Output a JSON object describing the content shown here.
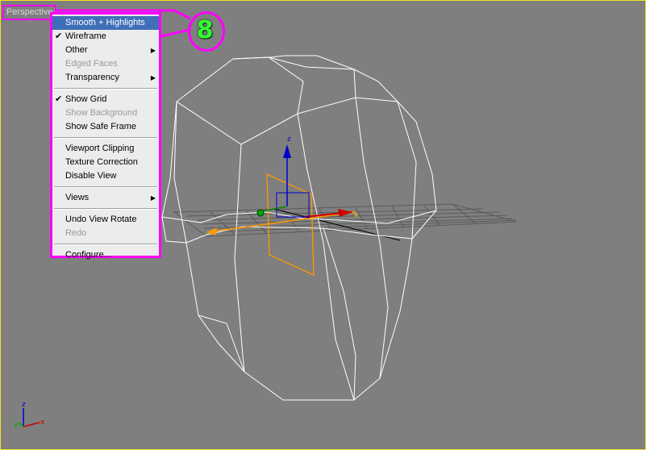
{
  "viewport": {
    "label": "Perspective",
    "background_color": "#7f7f7f",
    "active_border_color": "#f2e21d"
  },
  "annotation": {
    "number": "8",
    "outline_color": "#ff00ff",
    "number_color": "#33ff33"
  },
  "axis_tripod": {
    "z": "z",
    "y": "y",
    "x": "x"
  },
  "gizmo": {
    "z": "z",
    "x": "x"
  },
  "context_menu": {
    "highlight_color": "#3f6fb8",
    "items": [
      {
        "label": "Smooth + Highlights",
        "highlighted": true,
        "enabled": true,
        "checked": false,
        "submenu": false
      },
      {
        "label": "Wireframe",
        "highlighted": false,
        "enabled": true,
        "checked": true,
        "submenu": false
      },
      {
        "label": "Other",
        "highlighted": false,
        "enabled": true,
        "checked": false,
        "submenu": true
      },
      {
        "label": "Edged Faces",
        "highlighted": false,
        "enabled": false,
        "checked": false,
        "submenu": false
      },
      {
        "label": "Transparency",
        "highlighted": false,
        "enabled": true,
        "checked": false,
        "submenu": true
      },
      {
        "separator": true
      },
      {
        "label": "Show Grid",
        "highlighted": false,
        "enabled": true,
        "checked": true,
        "submenu": false
      },
      {
        "label": "Show Background",
        "highlighted": false,
        "enabled": false,
        "checked": false,
        "submenu": false
      },
      {
        "label": "Show Safe Frame",
        "highlighted": false,
        "enabled": true,
        "checked": false,
        "submenu": false
      },
      {
        "separator": true
      },
      {
        "label": "Viewport Clipping",
        "highlighted": false,
        "enabled": true,
        "checked": false,
        "submenu": false
      },
      {
        "label": "Texture Correction",
        "highlighted": false,
        "enabled": true,
        "checked": false,
        "submenu": false
      },
      {
        "label": "Disable View",
        "highlighted": false,
        "enabled": true,
        "checked": false,
        "submenu": false
      },
      {
        "separator": true
      },
      {
        "label": "Views",
        "highlighted": false,
        "enabled": true,
        "checked": false,
        "submenu": true
      },
      {
        "separator": true
      },
      {
        "label": "Undo View Rotate",
        "highlighted": false,
        "enabled": true,
        "checked": false,
        "submenu": false
      },
      {
        "label": "Redo",
        "highlighted": false,
        "enabled": false,
        "checked": false,
        "submenu": false
      },
      {
        "separator": true
      },
      {
        "label": "Configure...",
        "highlighted": false,
        "enabled": true,
        "checked": false,
        "submenu": false
      }
    ]
  }
}
